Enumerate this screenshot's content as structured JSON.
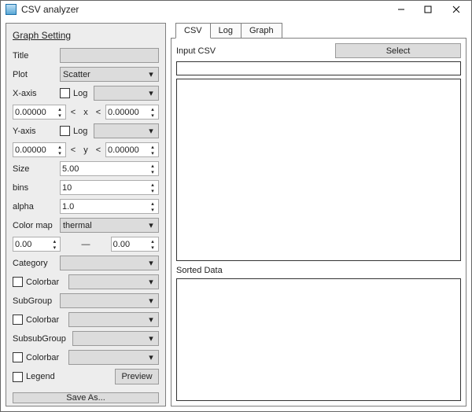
{
  "window": {
    "title": "CSV analyzer"
  },
  "left": {
    "heading": "Graph Setting",
    "title_label": "Title",
    "plot_label": "Plot",
    "plot_value": "Scatter",
    "xaxis_label": "X-axis",
    "yaxis_label": "Y-axis",
    "log_label": "Log",
    "lt": "<",
    "x_var": "x",
    "y_var": "y",
    "x_min": "0.00000",
    "x_max": "0.00000",
    "y_min": "0.00000",
    "y_max": "0.00000",
    "size_label": "Size",
    "size_value": "5.00",
    "bins_label": "bins",
    "bins_value": "10",
    "alpha_label": "alpha",
    "alpha_value": "1.0",
    "colormap_label": "Color map",
    "colormap_value": "thermal",
    "cmap_min": "0.00",
    "cmap_max": "0.00",
    "dash": "—",
    "category_label": "Category",
    "colorbar_label": "Colorbar",
    "subgroup_label": "SubGroup",
    "subsubgroup_label": "SubsubGroup",
    "legend_label": "Legend",
    "preview_btn": "Preview",
    "saveas_btn": "Save As..."
  },
  "right": {
    "tabs": [
      "CSV",
      "Log",
      "Graph"
    ],
    "input_label": "Input CSV",
    "select_btn": "Select",
    "sorted_label": "Sorted Data"
  }
}
